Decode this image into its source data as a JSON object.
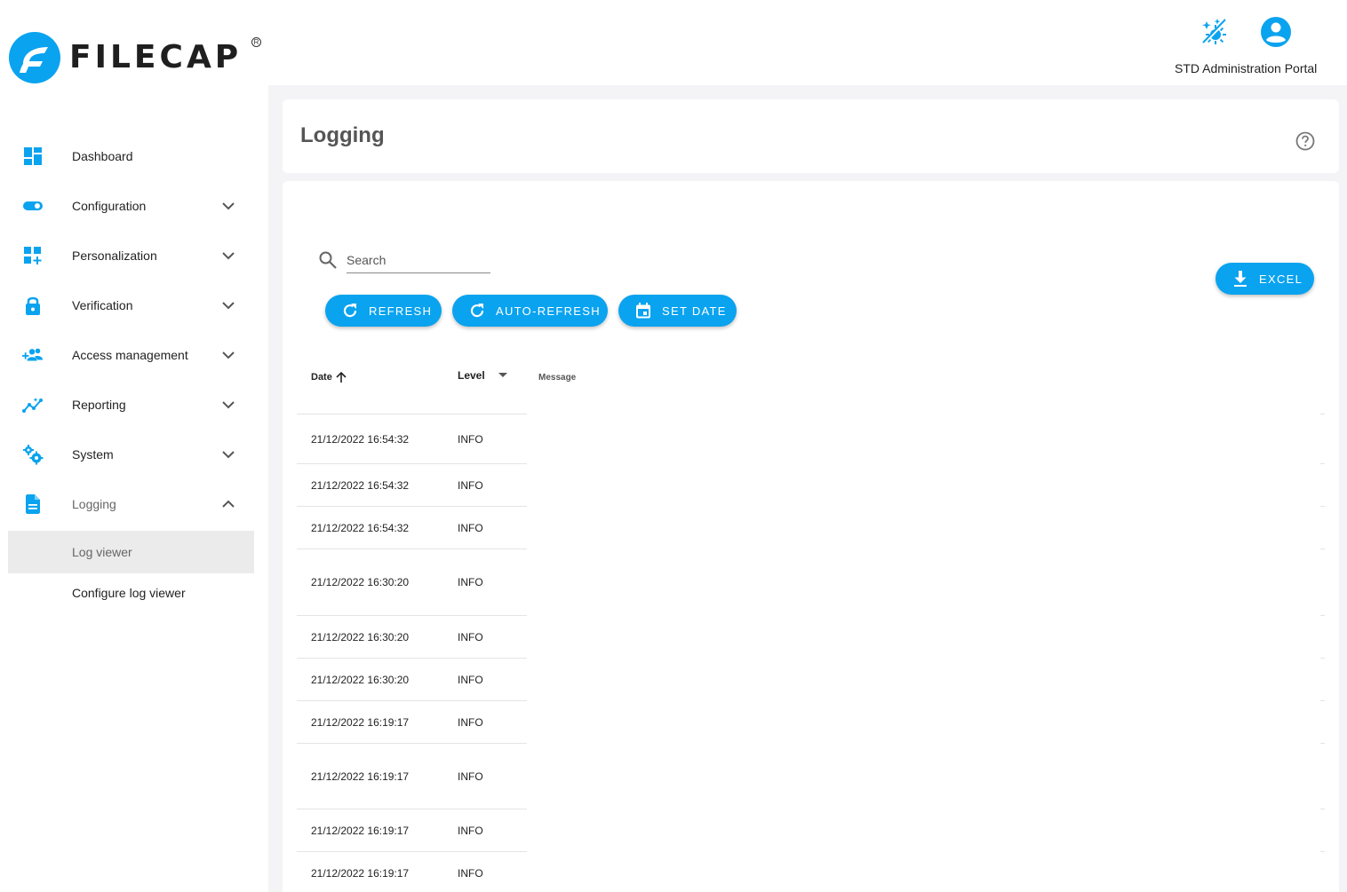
{
  "brand": {
    "name": "FILECAP",
    "registered": "R",
    "accent": "#0aa3ef"
  },
  "header": {
    "portal_label": "STD Administration Portal",
    "icons": [
      "theme-toggle-icon",
      "account-circle-icon"
    ]
  },
  "sidebar": {
    "items": [
      {
        "label": "Dashboard",
        "icon": "dashboard-icon",
        "expandable": false
      },
      {
        "label": "Configuration",
        "icon": "toggle-icon",
        "expandable": true
      },
      {
        "label": "Personalization",
        "icon": "widgets-add-icon",
        "expandable": true
      },
      {
        "label": "Verification",
        "icon": "lock-icon",
        "expandable": true
      },
      {
        "label": "Access management",
        "icon": "group-add-icon",
        "expandable": true
      },
      {
        "label": "Reporting",
        "icon": "insights-icon",
        "expandable": true
      },
      {
        "label": "System",
        "icon": "gears-icon",
        "expandable": true
      },
      {
        "label": "Logging",
        "icon": "document-icon",
        "expandable": true,
        "expanded": true
      }
    ],
    "logging_children": [
      {
        "label": "Log viewer",
        "active": true
      },
      {
        "label": "Configure log viewer",
        "active": false
      }
    ]
  },
  "page": {
    "title": "Logging"
  },
  "toolbar": {
    "search_placeholder": "Search",
    "refresh_label": "REFRESH",
    "auto_refresh_label": "AUTO-REFRESH",
    "set_date_label": "SET DATE",
    "excel_label": "EXCEL"
  },
  "table": {
    "headers": {
      "date": "Date",
      "level": "Level",
      "message": "Message"
    },
    "rows": [
      {
        "date": "21/12/2022 16:54:32",
        "level": "INFO",
        "message": ""
      },
      {
        "date": "21/12/2022 16:54:32",
        "level": "INFO",
        "message": ""
      },
      {
        "date": "21/12/2022 16:54:32",
        "level": "INFO",
        "message": ""
      },
      {
        "date": "21/12/2022 16:30:20",
        "level": "INFO",
        "message": ""
      },
      {
        "date": "21/12/2022 16:30:20",
        "level": "INFO",
        "message": ""
      },
      {
        "date": "21/12/2022 16:30:20",
        "level": "INFO",
        "message": ""
      },
      {
        "date": "21/12/2022 16:19:17",
        "level": "INFO",
        "message": ""
      },
      {
        "date": "21/12/2022 16:19:17",
        "level": "INFO",
        "message": ""
      },
      {
        "date": "21/12/2022 16:19:17",
        "level": "INFO",
        "message": ""
      },
      {
        "date": "21/12/2022 16:19:17",
        "level": "INFO",
        "message": ""
      }
    ]
  }
}
